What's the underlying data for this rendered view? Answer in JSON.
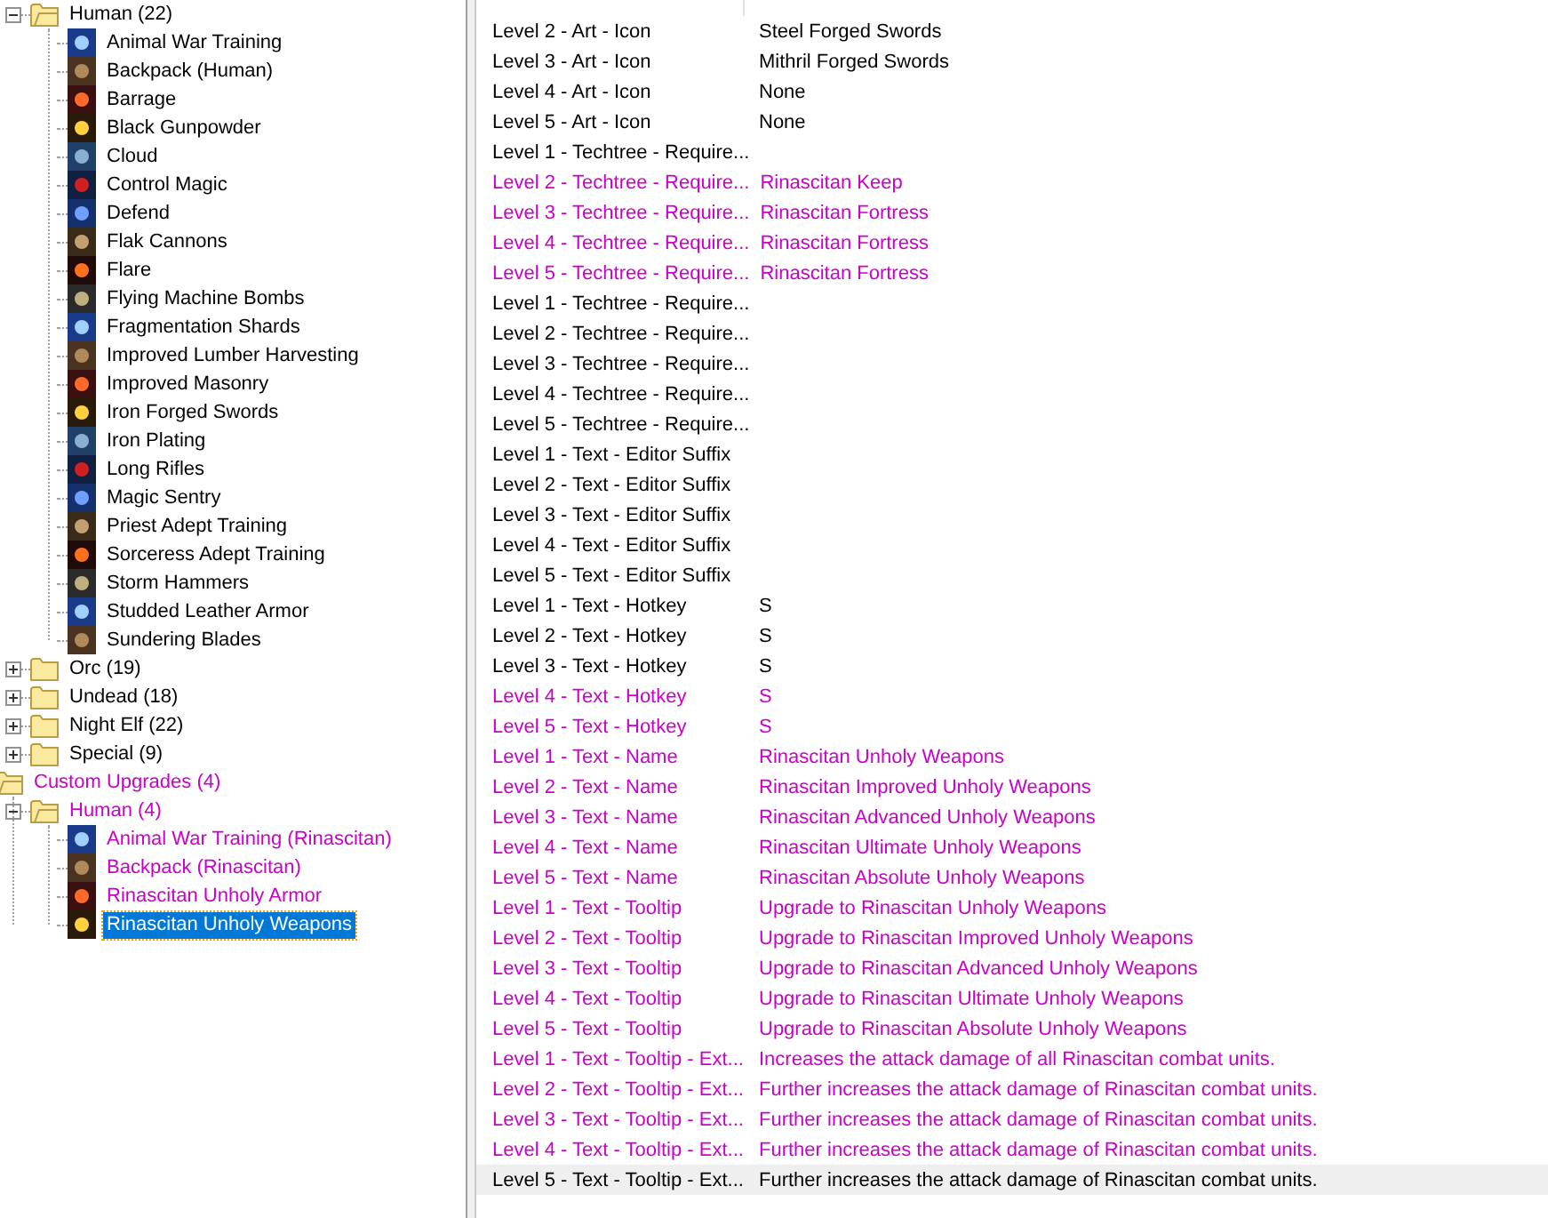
{
  "tree": [
    {
      "children": [
        {
          "label": "Human (22)",
          "expanded": true,
          "modified": false,
          "selected": false,
          "children": [
            {
              "label": "Animal War Training",
              "modified": false,
              "selected": false
            },
            {
              "label": "Backpack (Human)",
              "modified": false,
              "selected": false
            },
            {
              "label": "Barrage",
              "modified": false,
              "selected": false
            },
            {
              "label": "Black Gunpowder",
              "modified": false,
              "selected": false
            },
            {
              "label": "Cloud",
              "modified": false,
              "selected": false
            },
            {
              "label": "Control Magic",
              "modified": false,
              "selected": false
            },
            {
              "label": "Defend",
              "modified": false,
              "selected": false
            },
            {
              "label": "Flak Cannons",
              "modified": false,
              "selected": false
            },
            {
              "label": "Flare",
              "modified": false,
              "selected": false
            },
            {
              "label": "Flying Machine Bombs",
              "modified": false,
              "selected": false
            },
            {
              "label": "Fragmentation Shards",
              "modified": false,
              "selected": false
            },
            {
              "label": "Improved Lumber Harvesting",
              "modified": false,
              "selected": false
            },
            {
              "label": "Improved Masonry",
              "modified": false,
              "selected": false
            },
            {
              "label": "Iron Forged Swords",
              "modified": false,
              "selected": false
            },
            {
              "label": "Iron Plating",
              "modified": false,
              "selected": false
            },
            {
              "label": "Long Rifles",
              "modified": false,
              "selected": false
            },
            {
              "label": "Magic Sentry",
              "modified": false,
              "selected": false
            },
            {
              "label": "Priest Adept Training",
              "modified": false,
              "selected": false
            },
            {
              "label": "Sorceress Adept Training",
              "modified": false,
              "selected": false
            },
            {
              "label": "Storm Hammers",
              "modified": false,
              "selected": false
            },
            {
              "label": "Studded Leather Armor",
              "modified": false,
              "selected": false
            },
            {
              "label": "Sundering Blades",
              "modified": false,
              "selected": false
            }
          ]
        },
        {
          "label": "Orc (19)",
          "expanded": false,
          "modified": false,
          "selected": false
        },
        {
          "label": "Undead (18)",
          "expanded": false,
          "modified": false,
          "selected": false
        },
        {
          "label": "Night Elf (22)",
          "expanded": false,
          "modified": false,
          "selected": false
        },
        {
          "label": "Special (9)",
          "expanded": false,
          "modified": false,
          "selected": false
        }
      ]
    },
    {
      "label": "Custom Upgrades (4)",
      "expanded": true,
      "modified": true,
      "selected": false,
      "children": [
        {
          "label": "Human (4)",
          "expanded": true,
          "modified": true,
          "selected": false,
          "children": [
            {
              "label": "Animal War Training (Rinascitan)",
              "modified": true,
              "selected": false
            },
            {
              "label": "Backpack (Rinascitan)",
              "modified": true,
              "selected": false
            },
            {
              "label": "Rinascitan Unholy Armor",
              "modified": true,
              "selected": false
            },
            {
              "label": "Rinascitan Unholy Weapons",
              "modified": true,
              "selected": true
            }
          ]
        }
      ]
    }
  ],
  "fields": [
    {
      "name": "Level 2 - Art - Icon",
      "value": "Steel Forged Swords",
      "modified": false,
      "selected": false
    },
    {
      "name": "Level 3 - Art - Icon",
      "value": "Mithril Forged Swords",
      "modified": false,
      "selected": false
    },
    {
      "name": "Level 4 - Art - Icon",
      "value": "None",
      "modified": false,
      "selected": false
    },
    {
      "name": "Level 5 - Art - Icon",
      "value": "None",
      "modified": false,
      "selected": false
    },
    {
      "name": "Level 1 - Techtree - Require...",
      "modified": false,
      "selected": false
    },
    {
      "name": "Level 2 - Techtree - Require...",
      "value": "Rinascitan Keep",
      "modified": true,
      "selected": false
    },
    {
      "name": "Level 3 - Techtree - Require...",
      "value": "Rinascitan Fortress",
      "modified": true,
      "selected": false
    },
    {
      "name": "Level 4 - Techtree - Require...",
      "value": "Rinascitan Fortress",
      "modified": true,
      "selected": false
    },
    {
      "name": "Level 5 - Techtree - Require...",
      "value": "Rinascitan Fortress",
      "modified": true,
      "selected": false
    },
    {
      "name": "Level 1 - Techtree - Require...",
      "modified": false,
      "selected": false
    },
    {
      "name": "Level 2 - Techtree - Require...",
      "modified": false,
      "selected": false
    },
    {
      "name": "Level 3 - Techtree - Require...",
      "modified": false,
      "selected": false
    },
    {
      "name": "Level 4 - Techtree - Require...",
      "modified": false,
      "selected": false
    },
    {
      "name": "Level 5 - Techtree - Require...",
      "modified": false,
      "selected": false
    },
    {
      "name": "Level 1 - Text - Editor Suffix",
      "modified": false,
      "selected": false
    },
    {
      "name": "Level 2 - Text - Editor Suffix",
      "modified": false,
      "selected": false
    },
    {
      "name": "Level 3 - Text - Editor Suffix",
      "modified": false,
      "selected": false
    },
    {
      "name": "Level 4 - Text - Editor Suffix",
      "modified": false,
      "selected": false
    },
    {
      "name": "Level 5 - Text - Editor Suffix",
      "modified": false,
      "selected": false
    },
    {
      "name": "Level 1 - Text - Hotkey",
      "value": "S",
      "modified": false,
      "selected": false
    },
    {
      "name": "Level 2 - Text - Hotkey",
      "value": "S",
      "modified": false,
      "selected": false
    },
    {
      "name": "Level 3 - Text - Hotkey",
      "value": "S",
      "modified": false,
      "selected": false
    },
    {
      "name": "Level 4 - Text - Hotkey",
      "value": "S",
      "modified": true,
      "selected": false
    },
    {
      "name": "Level 5 - Text - Hotkey",
      "value": "S",
      "modified": true,
      "selected": false
    },
    {
      "name": "Level 1 - Text - Name",
      "value": "Rinascitan Unholy Weapons",
      "modified": true,
      "selected": false
    },
    {
      "name": "Level 2 - Text - Name",
      "value": "Rinascitan Improved Unholy Weapons",
      "modified": true,
      "selected": false
    },
    {
      "name": "Level 3 - Text - Name",
      "value": "Rinascitan Advanced Unholy Weapons",
      "modified": true,
      "selected": false
    },
    {
      "name": "Level 4 - Text - Name",
      "value": "Rinascitan Ultimate Unholy Weapons",
      "modified": true,
      "selected": false
    },
    {
      "name": "Level 5 - Text - Name",
      "value": "Rinascitan Absolute Unholy Weapons",
      "modified": true,
      "selected": false
    },
    {
      "name": "Level 1 - Text - Tooltip",
      "value": "Upgrade to Rinascitan Unholy Weapons",
      "modified": true,
      "selected": false
    },
    {
      "name": "Level 2 - Text - Tooltip",
      "value": "Upgrade to Rinascitan Improved Unholy Weapons",
      "modified": true,
      "selected": false
    },
    {
      "name": "Level 3 - Text - Tooltip",
      "value": "Upgrade to Rinascitan Advanced Unholy Weapons",
      "modified": true,
      "selected": false
    },
    {
      "name": "Level 4 - Text - Tooltip",
      "value": "Upgrade to Rinascitan Ultimate Unholy Weapons",
      "modified": true,
      "selected": false
    },
    {
      "name": "Level 5 - Text - Tooltip",
      "value": "Upgrade to Rinascitan Absolute Unholy Weapons",
      "modified": true,
      "selected": false
    },
    {
      "name": "Level 1 - Text - Tooltip - Ext...",
      "value": "Increases the attack damage of all Rinascitan combat units.",
      "modified": true,
      "selected": false
    },
    {
      "name": "Level 2 - Text - Tooltip - Ext...",
      "value": "Further increases the attack damage of Rinascitan combat units.",
      "modified": true,
      "selected": false
    },
    {
      "name": "Level 3 - Text - Tooltip - Ext...",
      "value": "Further increases the attack damage of Rinascitan combat units.",
      "modified": true,
      "selected": false
    },
    {
      "name": "Level 4 - Text - Tooltip - Ext...",
      "value": "Further increases the attack damage of Rinascitan combat units.",
      "modified": true,
      "selected": false
    },
    {
      "name": "Level 5 - Text - Tooltip - Ext...",
      "value": "Further increases the attack damage of Rinascitan combat units.",
      "modified": false,
      "selected": true
    }
  ]
}
